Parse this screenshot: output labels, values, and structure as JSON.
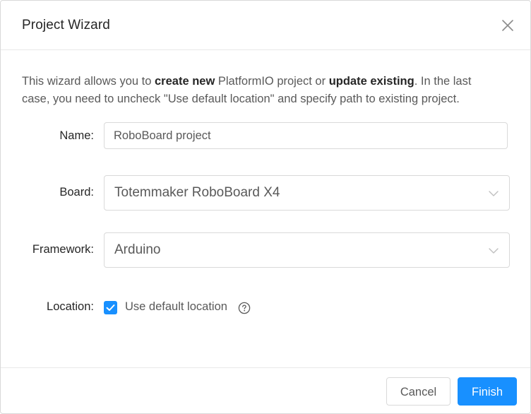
{
  "dialog": {
    "title": "Project Wizard",
    "close_icon": "close-icon"
  },
  "intro": {
    "part1": "This wizard allows you to ",
    "bold1": "create new",
    "part2": " PlatformIO project or ",
    "bold2": "update existing",
    "part3": ". In the last case, you need to uncheck \"Use default location\" and specify path to existing project."
  },
  "form": {
    "name_label": "Name:",
    "name_value": "RoboBoard project",
    "board_label": "Board:",
    "board_value": "Totemmaker RoboBoard X4",
    "framework_label": "Framework:",
    "framework_value": "Arduino",
    "location_label": "Location:",
    "use_default_location_label": "Use default location",
    "use_default_location_checked": true,
    "dropdown_icon": "chevron-down-icon",
    "help_icon": "question-circle-icon"
  },
  "footer": {
    "cancel_label": "Cancel",
    "finish_label": "Finish"
  },
  "colors": {
    "primary": "#1890ff",
    "border": "#d9d9d9",
    "text": "#595959",
    "heading": "#262626"
  }
}
